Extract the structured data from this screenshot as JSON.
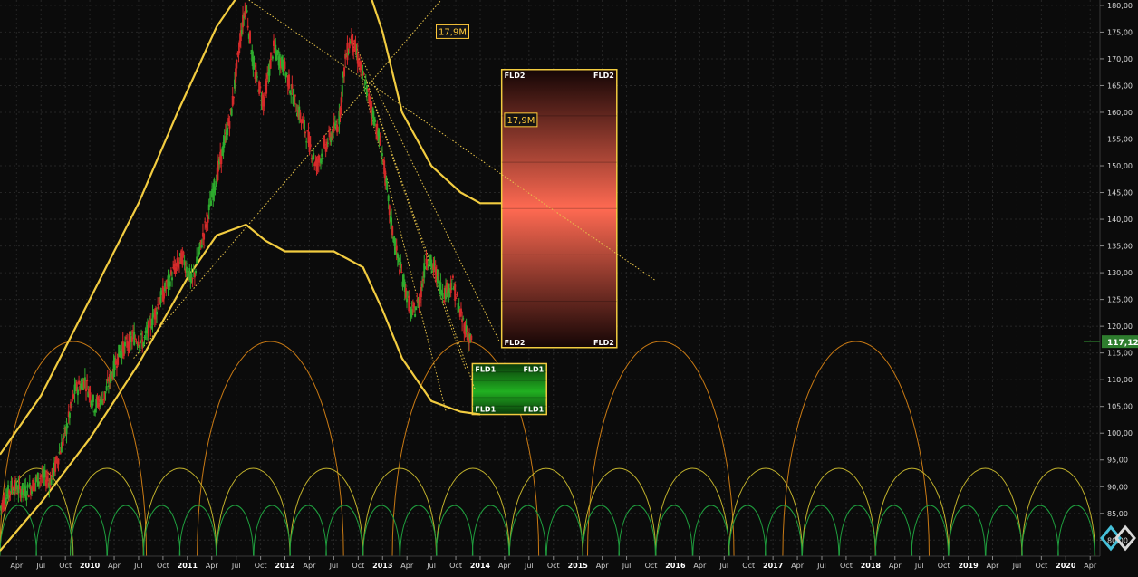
{
  "app": {
    "logo_icon": "diamond-logo-icon",
    "last_price": "117,12"
  },
  "colors": {
    "background": "#0b0b0b",
    "grid": "#262626",
    "envelope": "#f2cc40",
    "trendline": "#e8c44a",
    "bullish": "#2eab2e",
    "bearish": "#d42a2a",
    "cycle_large": "#c97a14",
    "cycle_medium": "#c2b22c",
    "cycle_small": "#1f9e3e",
    "fld2_box": "#ff6a52",
    "fld1_box": "#21b021",
    "price_badge": "#2e7d2e",
    "annotation": "#ffc93a"
  },
  "chart_data": {
    "type": "candlestick",
    "ylim": [
      77,
      181
    ],
    "xlim": [
      2009.08,
      2020.35
    ],
    "y_ticks": [
      "80,00",
      "85,00",
      "90,00",
      "95,00",
      "100,00",
      "105,00",
      "110,00",
      "115,00",
      "120,00",
      "125,00",
      "130,00",
      "135,00",
      "140,00",
      "145,00",
      "150,00",
      "155,00",
      "160,00",
      "165,00",
      "170,00",
      "175,00",
      "180,00"
    ],
    "x_ticks": [
      {
        "t": 2009.25,
        "label": "Apr"
      },
      {
        "t": 2009.5,
        "label": "Jul"
      },
      {
        "t": 2009.75,
        "label": "Oct"
      },
      {
        "t": 2010.0,
        "label": "2010"
      },
      {
        "t": 2010.25,
        "label": "Apr"
      },
      {
        "t": 2010.5,
        "label": "Jul"
      },
      {
        "t": 2010.75,
        "label": "Oct"
      },
      {
        "t": 2011.0,
        "label": "2011"
      },
      {
        "t": 2011.25,
        "label": "Apr"
      },
      {
        "t": 2011.5,
        "label": "Jul"
      },
      {
        "t": 2011.75,
        "label": "Oct"
      },
      {
        "t": 2012.0,
        "label": "2012"
      },
      {
        "t": 2012.25,
        "label": "Apr"
      },
      {
        "t": 2012.5,
        "label": "Jul"
      },
      {
        "t": 2012.75,
        "label": "Oct"
      },
      {
        "t": 2013.0,
        "label": "2013"
      },
      {
        "t": 2013.25,
        "label": "Apr"
      },
      {
        "t": 2013.5,
        "label": "Jul"
      },
      {
        "t": 2013.75,
        "label": "Oct"
      },
      {
        "t": 2014.0,
        "label": "2014"
      },
      {
        "t": 2014.25,
        "label": "Apr"
      },
      {
        "t": 2014.5,
        "label": "Jul"
      },
      {
        "t": 2014.75,
        "label": "Oct"
      },
      {
        "t": 2015.0,
        "label": "2015"
      },
      {
        "t": 2015.25,
        "label": "Apr"
      },
      {
        "t": 2015.5,
        "label": "Jul"
      },
      {
        "t": 2015.75,
        "label": "Oct"
      },
      {
        "t": 2016.0,
        "label": "2016"
      },
      {
        "t": 2016.25,
        "label": "Apr"
      },
      {
        "t": 2016.5,
        "label": "Jul"
      },
      {
        "t": 2016.75,
        "label": "Oct"
      },
      {
        "t": 2017.0,
        "label": "2017"
      },
      {
        "t": 2017.25,
        "label": "Apr"
      },
      {
        "t": 2017.5,
        "label": "Jul"
      },
      {
        "t": 2017.75,
        "label": "Oct"
      },
      {
        "t": 2018.0,
        "label": "2018"
      },
      {
        "t": 2018.25,
        "label": "Apr"
      },
      {
        "t": 2018.5,
        "label": "Jul"
      },
      {
        "t": 2018.75,
        "label": "Oct"
      },
      {
        "t": 2019.0,
        "label": "2019"
      },
      {
        "t": 2019.25,
        "label": "Apr"
      },
      {
        "t": 2019.5,
        "label": "Jul"
      },
      {
        "t": 2019.75,
        "label": "Oct"
      },
      {
        "t": 2020.0,
        "label": "2020"
      },
      {
        "t": 2020.25,
        "label": "Apr"
      }
    ],
    "price_path": [
      [
        2009.08,
        86
      ],
      [
        2009.2,
        90
      ],
      [
        2009.35,
        89
      ],
      [
        2009.5,
        92
      ],
      [
        2009.6,
        91
      ],
      [
        2009.75,
        100
      ],
      [
        2009.85,
        108
      ],
      [
        2009.95,
        110
      ],
      [
        2010.05,
        105
      ],
      [
        2010.15,
        107
      ],
      [
        2010.3,
        115
      ],
      [
        2010.45,
        118
      ],
      [
        2010.55,
        117
      ],
      [
        2010.7,
        124
      ],
      [
        2010.85,
        130
      ],
      [
        2010.95,
        133
      ],
      [
        2011.05,
        128
      ],
      [
        2011.2,
        140
      ],
      [
        2011.35,
        152
      ],
      [
        2011.45,
        160
      ],
      [
        2011.55,
        175
      ],
      [
        2011.6,
        180
      ],
      [
        2011.68,
        168
      ],
      [
        2011.78,
        162
      ],
      [
        2011.88,
        172
      ],
      [
        2012.0,
        168
      ],
      [
        2012.1,
        162
      ],
      [
        2012.22,
        156
      ],
      [
        2012.32,
        150
      ],
      [
        2012.45,
        155
      ],
      [
        2012.55,
        158
      ],
      [
        2012.62,
        170
      ],
      [
        2012.68,
        174
      ],
      [
        2012.78,
        168
      ],
      [
        2012.9,
        160
      ],
      [
        2013.0,
        152
      ],
      [
        2013.08,
        140
      ],
      [
        2013.15,
        133
      ],
      [
        2013.22,
        128
      ],
      [
        2013.3,
        122
      ],
      [
        2013.38,
        125
      ],
      [
        2013.45,
        133
      ],
      [
        2013.55,
        130
      ],
      [
        2013.62,
        126
      ],
      [
        2013.72,
        128
      ],
      [
        2013.8,
        122
      ],
      [
        2013.88,
        118
      ],
      [
        2013.92,
        117.12
      ]
    ],
    "envelope_upper": [
      [
        2009.08,
        96
      ],
      [
        2009.5,
        107
      ],
      [
        2010.0,
        125
      ],
      [
        2010.5,
        143
      ],
      [
        2010.9,
        160
      ],
      [
        2011.3,
        176
      ],
      [
        2011.6,
        184
      ],
      [
        2012.0,
        188
      ],
      [
        2012.4,
        190
      ],
      [
        2012.8,
        186
      ],
      [
        2013.0,
        175
      ],
      [
        2013.2,
        160
      ],
      [
        2013.5,
        150
      ],
      [
        2013.8,
        145
      ],
      [
        2014.0,
        143
      ],
      [
        2014.22,
        143
      ]
    ],
    "envelope_lower": [
      [
        2009.08,
        78
      ],
      [
        2009.5,
        87
      ],
      [
        2010.0,
        99
      ],
      [
        2010.5,
        113
      ],
      [
        2011.0,
        129
      ],
      [
        2011.3,
        137
      ],
      [
        2011.6,
        139
      ],
      [
        2011.8,
        136
      ],
      [
        2012.0,
        134
      ],
      [
        2012.5,
        134
      ],
      [
        2012.8,
        131
      ],
      [
        2013.0,
        123
      ],
      [
        2013.2,
        114
      ],
      [
        2013.5,
        106
      ],
      [
        2013.8,
        104
      ],
      [
        2014.0,
        103.5
      ]
    ],
    "trendlines": [
      {
        "from": [
          2010.45,
          114
        ],
        "to": [
          2013.6,
          181
        ]
      },
      {
        "from": [
          2011.55,
          182
        ],
        "to": [
          2015.8,
          128.5
        ]
      },
      {
        "from": [
          2012.68,
          174
        ],
        "to": [
          2014.2,
          117
        ]
      },
      {
        "from": [
          2012.68,
          174
        ],
        "to": [
          2013.85,
          112
        ]
      },
      {
        "from": [
          2012.68,
          174
        ],
        "to": [
          2013.65,
          104
        ]
      },
      {
        "from": [
          2012.68,
          174
        ],
        "to": [
          2013.95,
          108
        ]
      }
    ],
    "annotations": [
      {
        "label": "17,9M",
        "t": 2013.55,
        "price": 175
      },
      {
        "label": "17,9M",
        "t": 2014.25,
        "price": 158.5
      }
    ],
    "fld_boxes": [
      {
        "label": "FLD2",
        "t0": 2014.22,
        "t1": 2015.4,
        "top": 168,
        "bottom": 116,
        "fill": "fld2"
      },
      {
        "label": "FLD1",
        "t0": 2013.92,
        "t1": 2014.68,
        "top": 113,
        "bottom": 103.5,
        "fill": "fld1"
      }
    ],
    "cycles": [
      {
        "name": "cycle-large",
        "color": "cycle_large",
        "starts": [
          2009.08,
          2011.1,
          2013.1,
          2015.1,
          2017.1
        ],
        "width": 1.5
      },
      {
        "name": "cycle-medium",
        "color": "cycle_medium",
        "starts": [
          2009.08,
          2009.8,
          2010.55,
          2011.3,
          2012.05,
          2012.8,
          2013.55,
          2014.3,
          2015.05,
          2015.8,
          2016.55,
          2017.3,
          2018.05,
          2018.8,
          2019.55
        ],
        "width": 0.75
      },
      {
        "name": "cycle-small",
        "color": "cycle_small",
        "starts": [
          2009.08,
          2009.45,
          2009.8,
          2010.18,
          2010.55,
          2010.92,
          2011.3,
          2011.68,
          2012.05,
          2012.42,
          2012.8,
          2013.18,
          2013.55,
          2013.92,
          2014.3,
          2014.68,
          2015.05,
          2015.42,
          2015.8,
          2016.18,
          2016.55,
          2016.92,
          2017.3,
          2017.68,
          2018.05,
          2018.42,
          2018.8,
          2019.18,
          2019.55,
          2019.92
        ],
        "width": 0.375
      }
    ]
  }
}
